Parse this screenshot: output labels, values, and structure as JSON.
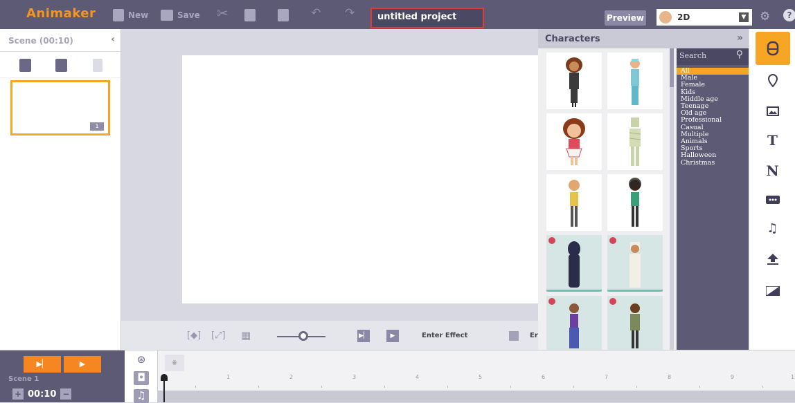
{
  "app": {
    "logo": "Animaker"
  },
  "toolbar": {
    "new_label": "New",
    "save_label": "Save",
    "project_title": "untitled project",
    "preview_label": "Preview",
    "mode_value": "2D"
  },
  "scene_panel": {
    "header": "Scene  (00:10)",
    "scene_number": "1"
  },
  "stage_toolbar": {
    "enter_effect_label": "Enter Effect",
    "exit_effect_label": "Er"
  },
  "characters": {
    "title": "Characters",
    "search_placeholder": "Search",
    "categories": [
      "All",
      "Male",
      "Female",
      "Kids",
      "Middle age",
      "Teenage",
      "Old age",
      "Professional",
      "Casual",
      "Multiple",
      "Animals",
      "Sports",
      "Halloween",
      "Christmas"
    ],
    "selected_category": "All"
  },
  "right_bar": {
    "items": [
      "characters-icon",
      "location-pin-icon",
      "image-icon",
      "text-icon",
      "number-icon",
      "caption-icon",
      "music-icon",
      "upload-icon",
      "background-icon"
    ]
  },
  "timeline": {
    "scene_label": "Scene 1",
    "duration": "00:10",
    "ruler": [
      "1",
      "2",
      "3",
      "4",
      "5",
      "6",
      "7",
      "8",
      "9",
      "1"
    ]
  },
  "colors": {
    "topbar": "#5c5a75",
    "accent": "#f6a623",
    "play": "#f6861f",
    "highlight_border": "#e53935"
  }
}
